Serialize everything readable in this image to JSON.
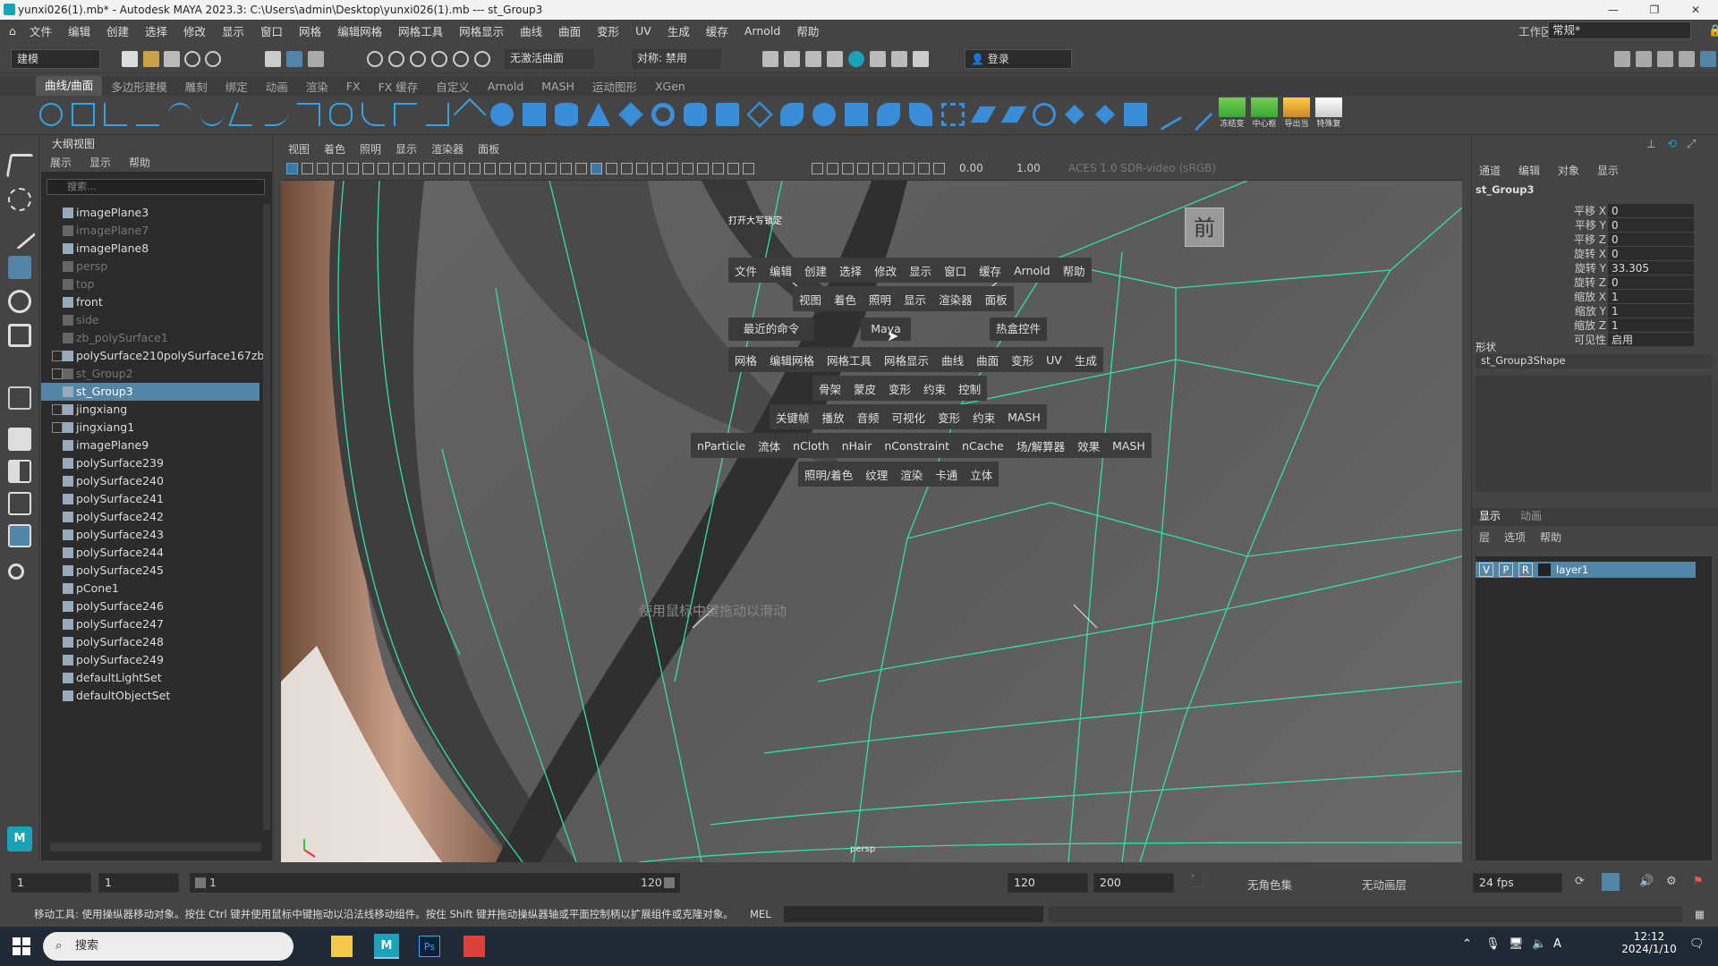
{
  "window": {
    "title": "yunxi026(1).mb* - Autodesk MAYA 2023.3: C:\\Users\\admin\\Desktop\\yunxi026(1).mb  ---  st_Group3"
  },
  "menubar": [
    "文件",
    "编辑",
    "创建",
    "选择",
    "修改",
    "显示",
    "窗口",
    "网格",
    "编辑网格",
    "网格工具",
    "网格显示",
    "曲线",
    "曲面",
    "变形",
    "UV",
    "生成",
    "缓存",
    "Arnold",
    "帮助"
  ],
  "workspace": {
    "label": "工作区:",
    "value": "常规*"
  },
  "toolbar": {
    "mode": "建模",
    "live_surface": "无激活曲面",
    "symmetry": "对称: 禁用",
    "login": "登录"
  },
  "shelf_tabs": [
    "曲线/曲面",
    "多边形建模",
    "雕刻",
    "绑定",
    "动画",
    "渲染",
    "FX",
    "FX 缓存",
    "自定义",
    "Arnold",
    "MASH",
    "运动图形",
    "XGen"
  ],
  "shelf_active": "曲线/曲面",
  "shelf_icon_labels": [
    "冻结变",
    "中心枢",
    "导出当",
    "特殊复"
  ],
  "outliner": {
    "title": "大纲视图",
    "menu": [
      "展示",
      "显示",
      "帮助"
    ],
    "search_placeholder": "搜索...",
    "items": [
      {
        "label": "imagePlane3",
        "dim": false,
        "expand": false
      },
      {
        "label": "imagePlane7",
        "dim": true,
        "expand": false
      },
      {
        "label": "imagePlane8",
        "dim": false,
        "expand": false
      },
      {
        "label": "persp",
        "dim": true,
        "expand": false
      },
      {
        "label": "top",
        "dim": true,
        "expand": false
      },
      {
        "label": "front",
        "dim": false,
        "expand": false
      },
      {
        "label": "side",
        "dim": true,
        "expand": false
      },
      {
        "label": "zb_polySurface1",
        "dim": true,
        "expand": false
      },
      {
        "label": "polySurface210polySurface167zb",
        "dim": false,
        "expand": true
      },
      {
        "label": "st_Group2",
        "dim": true,
        "expand": true
      },
      {
        "label": "st_Group3",
        "dim": false,
        "expand": false,
        "selected": true
      },
      {
        "label": "jingxiang",
        "dim": false,
        "expand": true
      },
      {
        "label": "jingxiang1",
        "dim": false,
        "expand": true
      },
      {
        "label": "imagePlane9",
        "dim": false,
        "expand": false
      },
      {
        "label": "polySurface239",
        "dim": false,
        "expand": false
      },
      {
        "label": "polySurface240",
        "dim": false,
        "expand": false
      },
      {
        "label": "polySurface241",
        "dim": false,
        "expand": false
      },
      {
        "label": "polySurface242",
        "dim": false,
        "expand": false
      },
      {
        "label": "polySurface243",
        "dim": false,
        "expand": false
      },
      {
        "label": "polySurface244",
        "dim": false,
        "expand": false
      },
      {
        "label": "polySurface245",
        "dim": false,
        "expand": false
      },
      {
        "label": "pCone1",
        "dim": false,
        "expand": false
      },
      {
        "label": "polySurface246",
        "dim": false,
        "expand": false
      },
      {
        "label": "polySurface247",
        "dim": false,
        "expand": false
      },
      {
        "label": "polySurface248",
        "dim": false,
        "expand": false
      },
      {
        "label": "polySurface249",
        "dim": false,
        "expand": false
      },
      {
        "label": "defaultLightSet",
        "dim": false,
        "expand": false
      },
      {
        "label": "defaultObjectSet",
        "dim": false,
        "expand": false
      }
    ]
  },
  "viewport": {
    "menu": [
      "视图",
      "着色",
      "照明",
      "显示",
      "渲染器",
      "面板"
    ],
    "field1": "0.00",
    "field2": "1.00",
    "colorspace": "ACES 1.0 SDR-video (sRGB)",
    "caps_lock": "打开大写锁定",
    "view_cube": "前",
    "camera": "persp",
    "hint": "使用鼠标中键拖动以滑动"
  },
  "marking_menu": {
    "row1": [
      "文件",
      "编辑",
      "创建",
      "选择",
      "修改",
      "显示",
      "窗口",
      "缓存",
      "Arnold",
      "帮助"
    ],
    "row2": [
      "视图",
      "着色",
      "照明",
      "显示",
      "渲染器",
      "面板"
    ],
    "left": "最近的命令",
    "center": "Maya",
    "right": "热盒控件",
    "row3": [
      "网格",
      "编辑网格",
      "网格工具",
      "网格显示",
      "曲线",
      "曲面",
      "变形",
      "UV",
      "生成"
    ],
    "row4": [
      "骨架",
      "蒙皮",
      "变形",
      "约束",
      "控制"
    ],
    "row5": [
      "关键帧",
      "播放",
      "音频",
      "可视化",
      "变形",
      "约束",
      "MASH"
    ],
    "row6": [
      "nParticle",
      "流体",
      "nCloth",
      "nHair",
      "nConstraint",
      "nCache",
      "场/解算器",
      "效果",
      "MASH"
    ],
    "row7": [
      "照明/着色",
      "纹理",
      "渲染",
      "卡通",
      "立体"
    ]
  },
  "channel_box": {
    "menu": [
      "通道",
      "编辑",
      "对象",
      "显示"
    ],
    "object": "st_Group3",
    "attrs": [
      {
        "name": "平移 X",
        "value": "0"
      },
      {
        "name": "平移 Y",
        "value": "0"
      },
      {
        "name": "平移 Z",
        "value": "0"
      },
      {
        "name": "旋转 X",
        "value": "0"
      },
      {
        "name": "旋转 Y",
        "value": "33.305"
      },
      {
        "name": "旋转 Z",
        "value": "0"
      },
      {
        "name": "缩放 X",
        "value": "1"
      },
      {
        "name": "缩放 Y",
        "value": "1"
      },
      {
        "name": "缩放 Z",
        "value": "1"
      },
      {
        "name": "可见性",
        "value": "启用"
      }
    ],
    "shapes_label": "形状",
    "shape_name": "st_Group3Shape",
    "layer_tabs": [
      "显示",
      "动画"
    ],
    "layer_menu": [
      "层",
      "选项",
      "帮助"
    ],
    "layer": {
      "v": "V",
      "p": "P",
      "r": "R",
      "name": "layer1"
    }
  },
  "timeline": {
    "start": "1",
    "current": "1",
    "range_start": "1",
    "range_end": "120",
    "end": "120",
    "anim_end": "200",
    "char_set": "无角色集",
    "anim_layer": "无动画层",
    "fps": "24 fps"
  },
  "help_line": "移动工具: 使用操纵器移动对象。按住 Ctrl 键并使用鼠标中键拖动以沿法线移动组件。按住 Shift 键并拖动操纵器轴或平面控制柄以扩展组件或克隆对象。按住 C",
  "mel_label": "MEL",
  "taskbar": {
    "search": "搜索",
    "time": "12:12",
    "date": "2024/1/10",
    "ime": "A"
  },
  "colors": {
    "wire": "#33e0a8",
    "selected": "#5285a6",
    "maya_accent": "#1aa3b8"
  }
}
